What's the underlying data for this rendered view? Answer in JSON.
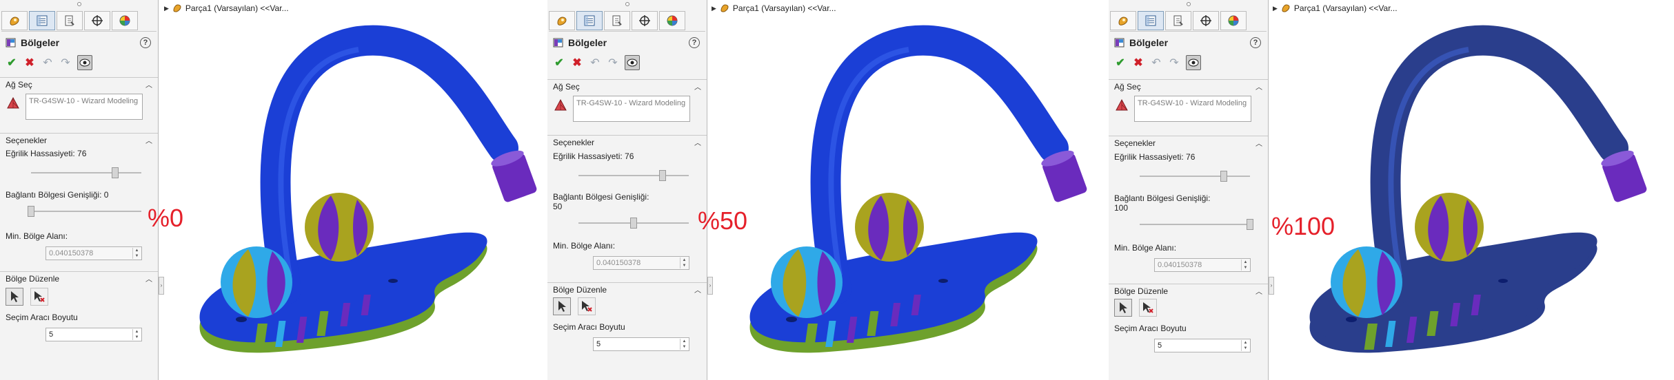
{
  "tabs": [
    "feature-manager-tab",
    "property-manager-tab",
    "configuration-manager-tab",
    "dimxpert-manager-tab",
    "display-manager-tab"
  ],
  "panel": {
    "title": "Bölgeler",
    "help": "?",
    "mesh_section": "Ağ Seç",
    "mesh_value": "TR-G4SW-10 - Wizard Modeling",
    "options_section": "Seçenekler",
    "curvature_label": "Eğrilik Hassasiyeti: 76",
    "curvature_level": 0.76,
    "min_area_label": "Min. Bölge Alanı:",
    "min_area_value": "0.040150378",
    "edit_section": "Bölge Düzenle",
    "tool_size_label": "Seçim Aracı Boyutu",
    "tool_size_value": "5",
    "spin_up": "▲",
    "spin_down": "▼"
  },
  "breadcrumb": "Parça1  (Varsayılan) <<Var...",
  "views": [
    {
      "connection_label": "Bağlantı Bölgesi Genişliği: 0",
      "connection_value": "",
      "connection_level": 0.0,
      "percent": "%0"
    },
    {
      "connection_label": "Bağlantı Bölgesi Genişliği:",
      "connection_value": "50",
      "connection_level": 0.5,
      "percent": "%50"
    },
    {
      "connection_label": "Bağlantı Bölgesi Genişliği:",
      "connection_value": "100",
      "connection_level": 1.0,
      "percent": "%100"
    }
  ],
  "colors": {
    "accent_red": "#e5202a",
    "faucet_blue": "#1b3fd6",
    "faucet_navy": "#2a3e8c",
    "segment_green": "#6ea12c",
    "segment_cyan": "#2fa9e8",
    "segment_olive": "#a9a31f",
    "segment_purple": "#6a2bbd"
  }
}
